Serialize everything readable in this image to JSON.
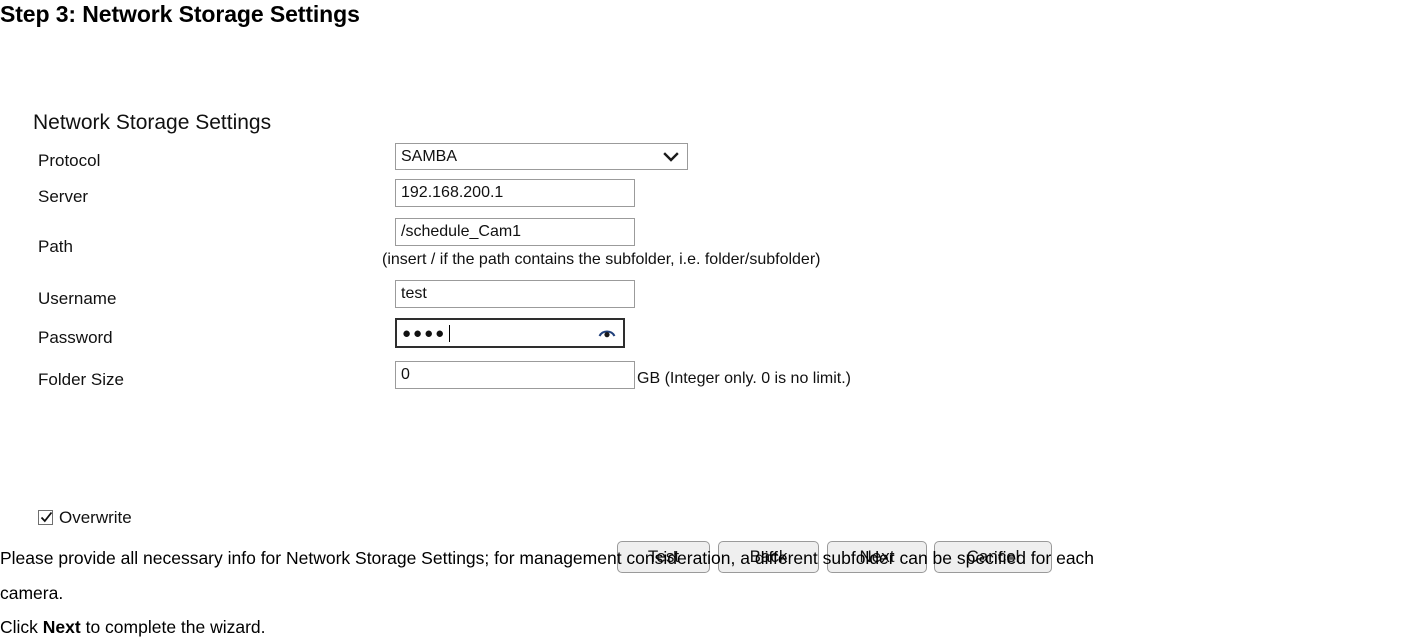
{
  "heading": "Step 3: Network Storage Settings",
  "panel": {
    "title": "Network Storage Settings",
    "labels": {
      "protocol": "Protocol",
      "server": "Server",
      "path": "Path",
      "username": "Username",
      "password": "Password",
      "folder_size": "Folder Size"
    },
    "protocol": {
      "selected": "SAMBA",
      "options": [
        "SAMBA"
      ]
    },
    "server": {
      "value": "192.168.200.1",
      "placeholder": ""
    },
    "path": {
      "value": "/schedule_Cam1",
      "placeholder": "",
      "hint": "(insert / if the path contains the subfolder, i.e. folder/subfolder)"
    },
    "username": {
      "value": "test",
      "placeholder": ""
    },
    "password": {
      "value": "●●●●",
      "placeholder": "",
      "reveal_icon": "eye-icon"
    },
    "folder_size": {
      "value": "0",
      "placeholder": "",
      "unit_hint": "GB (Integer only. 0 is no limit.)"
    },
    "overwrite": {
      "label": "Overwrite",
      "checked": true
    },
    "buttons": {
      "test": "Test",
      "back": "Back",
      "next": "Next",
      "cancel": "Cancel"
    }
  },
  "body": {
    "paragraph_line1": "Please provide all necessary info for Network Storage Settings; for management consideration, a different subfolder can be specified for each",
    "paragraph_line2": "camera.",
    "instruction_prefix": "Click ",
    "instruction_bold": "Next",
    "instruction_suffix": " to complete the wizard."
  }
}
